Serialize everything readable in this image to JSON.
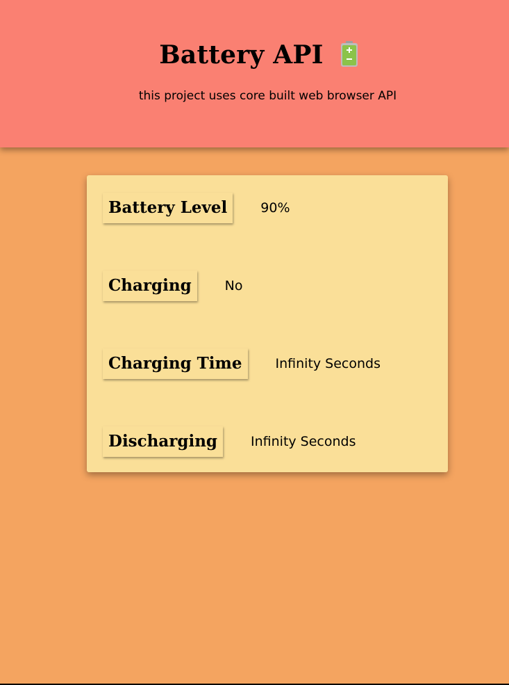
{
  "header": {
    "title": "Battery API",
    "subtitle": "this project uses core built web browser API",
    "icon": "battery-icon",
    "background": "#fa8072"
  },
  "page": {
    "background": "#f4a460"
  },
  "card": {
    "background": "#fadf98",
    "rows": [
      {
        "label": "Battery Level",
        "value": "90%"
      },
      {
        "label": "Charging",
        "value": "No"
      },
      {
        "label": "Charging Time",
        "value": "Infinity Seconds"
      },
      {
        "label": "Discharging",
        "value": "Infinity Seconds"
      }
    ]
  },
  "battery": {
    "level_percent": 90,
    "icon_color": "#8bc34a"
  }
}
